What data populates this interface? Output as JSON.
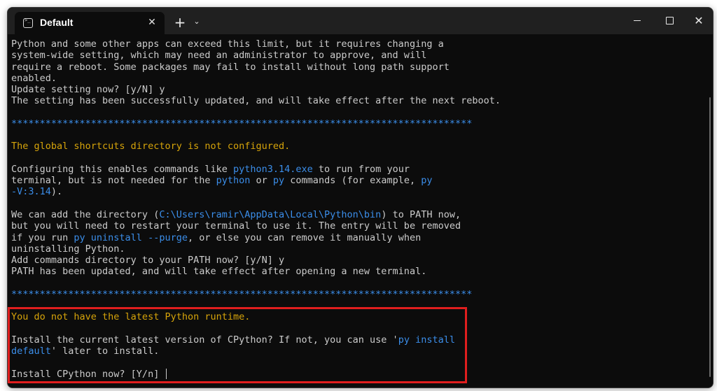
{
  "titlebar": {
    "tab_title": "Default",
    "tab_close": "✕",
    "new_tab": "+",
    "dropdown": "⌄",
    "close_symbol": "✕"
  },
  "terminal": {
    "lines": [
      [
        {
          "t": "Python and some other apps can exceed this limit, but it requires changing a"
        }
      ],
      [
        {
          "t": "system-wide setting, which may need an administrator to approve, and will"
        }
      ],
      [
        {
          "t": "require a reboot. Some packages may fail to install without long path support"
        }
      ],
      [
        {
          "t": "enabled."
        }
      ],
      [
        {
          "t": "Update setting now? [y/N] y"
        }
      ],
      [
        {
          "t": "The setting has been successfully updated, and will take effect after the next reboot."
        }
      ],
      [
        {
          "t": ""
        }
      ],
      [
        {
          "t": "*********************************************************************************",
          "c": "b"
        }
      ],
      [
        {
          "t": ""
        }
      ],
      [
        {
          "t": "The global shortcuts directory is not configured.",
          "c": "y"
        }
      ],
      [
        {
          "t": ""
        }
      ],
      [
        {
          "t": "Configuring this enables commands like "
        },
        {
          "t": "python3.14.exe",
          "c": "b"
        },
        {
          "t": " to run from your"
        }
      ],
      [
        {
          "t": "terminal, but is not needed for the "
        },
        {
          "t": "python",
          "c": "b"
        },
        {
          "t": " or "
        },
        {
          "t": "py",
          "c": "b"
        },
        {
          "t": " commands (for example, "
        },
        {
          "t": "py",
          "c": "b"
        }
      ],
      [
        {
          "t": "-V:3.14",
          "c": "b"
        },
        {
          "t": ")."
        }
      ],
      [
        {
          "t": ""
        }
      ],
      [
        {
          "t": "We can add the directory ("
        },
        {
          "t": "C:\\Users\\ramir\\AppData\\Local\\Python\\bin",
          "c": "b"
        },
        {
          "t": ") to PATH now,"
        }
      ],
      [
        {
          "t": "but you will need to restart your terminal to use it. The entry will be removed"
        }
      ],
      [
        {
          "t": "if you run "
        },
        {
          "t": "py uninstall --purge",
          "c": "b"
        },
        {
          "t": ", or else you can remove it manually when"
        }
      ],
      [
        {
          "t": "uninstalling Python."
        }
      ],
      [
        {
          "t": "Add commands directory to your PATH now? [y/N] y"
        }
      ],
      [
        {
          "t": "PATH has been updated, and will take effect after opening a new terminal."
        }
      ],
      [
        {
          "t": ""
        }
      ],
      [
        {
          "t": "*********************************************************************************",
          "c": "b"
        }
      ],
      [
        {
          "t": ""
        }
      ],
      [
        {
          "t": "You do not have the latest Python runtime.",
          "c": "y"
        }
      ],
      [
        {
          "t": ""
        }
      ],
      [
        {
          "t": "Install the current latest version of CPython? If not, you can use '"
        },
        {
          "t": "py install",
          "c": "b"
        }
      ],
      [
        {
          "t": "default",
          "c": "b"
        },
        {
          "t": "' later to install."
        }
      ],
      [
        {
          "t": ""
        }
      ],
      [
        {
          "t": "Install CPython now? [Y/n] "
        }
      ]
    ]
  },
  "colors": {
    "terminal_bg": "#0c0c0c",
    "text": "#cccccc",
    "yellow": "#d6a40a",
    "blue": "#3b8eea",
    "highlight_border": "#e01e1e"
  },
  "icons": [
    "terminal-icon",
    "close-icon",
    "plus-icon",
    "chevron-down-icon",
    "minimize-icon",
    "maximize-icon"
  ]
}
